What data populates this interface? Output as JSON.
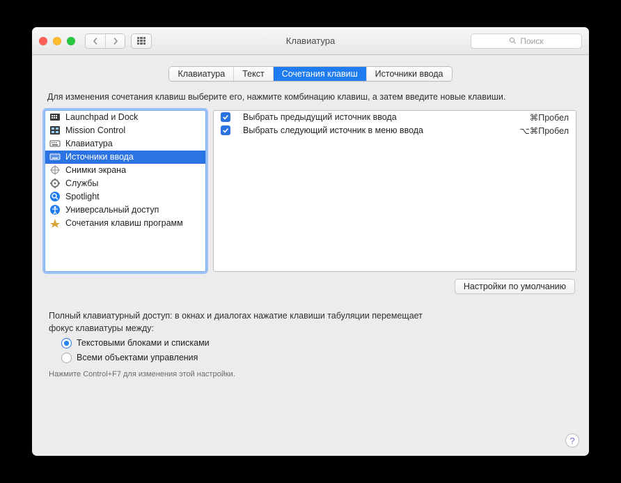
{
  "window": {
    "title": "Клавиатура"
  },
  "search": {
    "placeholder": "Поиск"
  },
  "tabs": [
    {
      "label": "Клавиатура",
      "active": false
    },
    {
      "label": "Текст",
      "active": false
    },
    {
      "label": "Сочетания клавиш",
      "active": true
    },
    {
      "label": "Источники ввода",
      "active": false
    }
  ],
  "instruction": "Для изменения сочетания клавиш выберите его, нажмите комбинацию клавиш, а затем введите новые клавиши.",
  "categories": [
    {
      "label": "Launchpad и Dock",
      "selected": false,
      "icon": "launchpad-icon"
    },
    {
      "label": "Mission Control",
      "selected": false,
      "icon": "mission-control-icon"
    },
    {
      "label": "Клавиатура",
      "selected": false,
      "icon": "keyboard-icon"
    },
    {
      "label": "Источники ввода",
      "selected": true,
      "icon": "input-sources-icon"
    },
    {
      "label": "Снимки экрана",
      "selected": false,
      "icon": "screenshot-icon"
    },
    {
      "label": "Службы",
      "selected": false,
      "icon": "services-icon"
    },
    {
      "label": "Spotlight",
      "selected": false,
      "icon": "spotlight-icon"
    },
    {
      "label": "Универсальный доступ",
      "selected": false,
      "icon": "accessibility-icon"
    },
    {
      "label": "Сочетания клавиш программ",
      "selected": false,
      "icon": "app-shortcuts-icon"
    }
  ],
  "shortcuts": [
    {
      "enabled": true,
      "label": "Выбрать предыдущий источник ввода",
      "keys": "⌘Пробел"
    },
    {
      "enabled": true,
      "label": "Выбрать следующий источник в меню ввода",
      "keys": "⌥⌘Пробел"
    }
  ],
  "defaults_button": "Настройки по умолчанию",
  "kb_access": {
    "text": "Полный клавиатурный доступ: в окнах и диалогах нажатие клавиши табуляции перемещает фокус клавиатуры между:",
    "options": [
      {
        "label": "Текстовыми блоками и списками",
        "selected": true
      },
      {
        "label": "Всеми объектами управления",
        "selected": false
      }
    ],
    "hint": "Нажмите Control+F7 для изменения этой настройки."
  }
}
